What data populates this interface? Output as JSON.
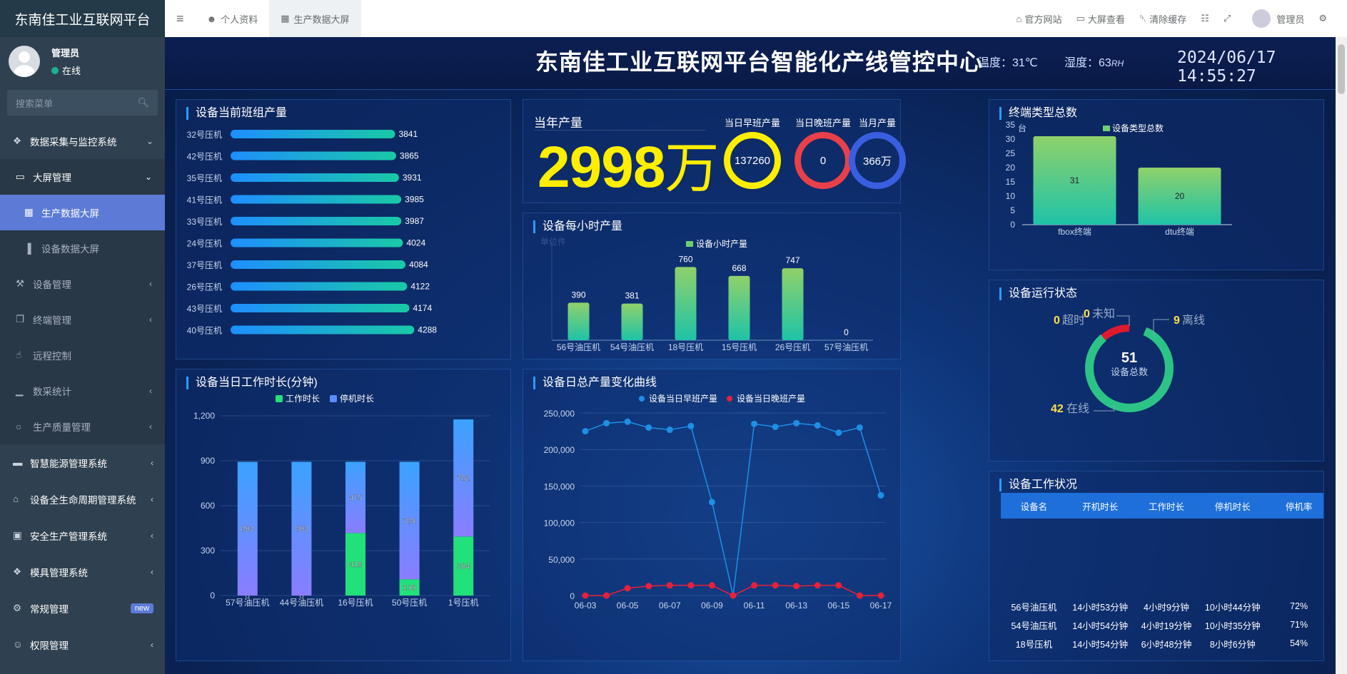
{
  "app": {
    "title": "东南佳工业互联网平台"
  },
  "user": {
    "name": "管理员",
    "status": "在线"
  },
  "search": {
    "placeholder": "搜索菜单"
  },
  "menu": {
    "s1": "数据采集与监控系统",
    "g1": "大屏管理",
    "g1a": "生产数据大屏",
    "g1b": "设备数据大屏",
    "g2": "设备管理",
    "g3": "终端管理",
    "g4": "远程控制",
    "g5": "数采统计",
    "g6": "生产质量管理",
    "s2": "智慧能源管理系统",
    "s3": "设备全生命周期管理系统",
    "s4": "安全生产管理系统",
    "s5": "模具管理系统",
    "s6": "常规管理",
    "s6badge": "new",
    "s7": "权限管理"
  },
  "topbar": {
    "tab1": "个人资料",
    "tab2": "生产数据大屏",
    "r1": "官方网站",
    "r2": "大屏查看",
    "r3": "清除缓存",
    "user": "管理员"
  },
  "dashboard": {
    "title": "东南佳工业互联网平台智能化产线管控中心",
    "temp": "温度：31℃",
    "humidity": "湿度：63",
    "humidity_unit": "RH",
    "datetime": "2024/06/17 14:55:27"
  },
  "panels": {
    "shift": "设备当前班组产量",
    "year": "当年产量",
    "hourly": "设备每小时产量",
    "terminal": "终端类型总数",
    "worktime": "设备当日工作时长(分钟)",
    "daily": "设备日总产量变化曲线",
    "runstate": "设备运行状态",
    "workstat": "设备工作状况"
  },
  "summary": {
    "year_value": "2998",
    "year_unit": "万",
    "morning_label": "当日早班产量",
    "morning_value": "137260",
    "evening_label": "当日晚班产量",
    "evening_value": "0",
    "month_label": "当月产量",
    "month_value": "366万",
    "colors": {
      "morning": "#ffee00",
      "evening": "#e8404a",
      "month": "#3a5ee0"
    }
  },
  "chart_data": [
    {
      "id": "shift",
      "type": "bar",
      "orientation": "horizontal",
      "categories": [
        "32号压机",
        "42号压机",
        "35号压机",
        "41号压机",
        "33号压机",
        "24号压机",
        "37号压机",
        "26号压机",
        "43号压机",
        "40号压机"
      ],
      "values": [
        3841,
        3865,
        3931,
        3985,
        3987,
        4024,
        4084,
        4122,
        4174,
        4288
      ],
      "xlim": [
        0,
        5000
      ]
    },
    {
      "id": "hourly",
      "type": "bar",
      "legend": "设备小时产量",
      "ylabel": "单位件",
      "categories": [
        "56号油压机",
        "54号油压机",
        "18号压机",
        "15号压机",
        "26号压机",
        "57号油压机"
      ],
      "values": [
        390,
        381,
        760,
        668,
        747,
        0
      ],
      "ylim": [
        0,
        800
      ]
    },
    {
      "id": "terminal",
      "type": "bar",
      "legend": "设备类型总数",
      "ylabel": "台",
      "categories": [
        "fbox终端",
        "dtu终端"
      ],
      "values": [
        31,
        20
      ],
      "yticks": [
        0,
        5,
        10,
        15,
        20,
        25,
        30,
        35
      ],
      "ylim": [
        0,
        35
      ]
    },
    {
      "id": "worktime",
      "type": "bar",
      "stacked": true,
      "categories": [
        "57号油压机",
        "44号油压机",
        "16号压机",
        "50号压机",
        "1号压机"
      ],
      "series": [
        {
          "name": "工作时长",
          "values": [
            0,
            0,
            418,
            109,
            394
          ],
          "color": "#22e07a"
        },
        {
          "name": "停机时长",
          "values": [
            893,
            893,
            475,
            784,
            782
          ],
          "color": "#5b8dff"
        }
      ],
      "yticks": [
        0,
        300,
        600,
        900,
        1200
      ],
      "ylim": [
        0,
        1200
      ]
    },
    {
      "id": "daily",
      "type": "line",
      "x": [
        "06-03",
        "06-04",
        "06-05",
        "06-06",
        "06-07",
        "06-08",
        "06-09",
        "06-10",
        "06-11",
        "06-12",
        "06-13",
        "06-14",
        "06-15",
        "06-16",
        "06-17"
      ],
      "xticks": [
        "06-03",
        "06-05",
        "06-07",
        "06-09",
        "06-11",
        "06-13",
        "06-15",
        "06-17"
      ],
      "series": [
        {
          "name": "设备当日早班产量",
          "values": [
            225000,
            236000,
            238000,
            230000,
            227000,
            232000,
            128000,
            0,
            235000,
            231000,
            236000,
            233000,
            223000,
            230000,
            137260
          ],
          "color": "#1f8fe6"
        },
        {
          "name": "设备当日晚班产量",
          "values": [
            0,
            0,
            10000,
            13000,
            14000,
            14000,
            14000,
            0,
            14000,
            14000,
            13000,
            14000,
            14000,
            0,
            0
          ],
          "color": "#e8203a"
        }
      ],
      "yticks": [
        0,
        50000,
        100000,
        150000,
        200000,
        250000
      ],
      "ylim": [
        0,
        250000
      ]
    },
    {
      "id": "runstate",
      "type": "pie",
      "center_value": "51",
      "center_label": "设备总数",
      "slices": [
        {
          "name": "在线",
          "value": 42,
          "color": "#2cc486"
        },
        {
          "name": "离线",
          "value": 9,
          "color": "#e01a2e"
        },
        {
          "name": "超时",
          "value": 0,
          "color": "#ffdd44"
        },
        {
          "name": "未知",
          "value": 0,
          "color": "#888888"
        }
      ]
    },
    {
      "id": "workstat",
      "type": "table",
      "columns": [
        "设备名",
        "开机时长",
        "工作时长",
        "停机时长",
        "停机率"
      ],
      "rows": [
        [
          "56号油压机",
          "14小时53分钟",
          "4小时9分钟",
          "10小时44分钟",
          "72%"
        ],
        [
          "54号油压机",
          "14小时54分钟",
          "4小时19分钟",
          "10小时35分钟",
          "71%"
        ],
        [
          "18号压机",
          "14小时54分钟",
          "6小时48分钟",
          "8小时6分钟",
          "54%"
        ]
      ]
    }
  ]
}
